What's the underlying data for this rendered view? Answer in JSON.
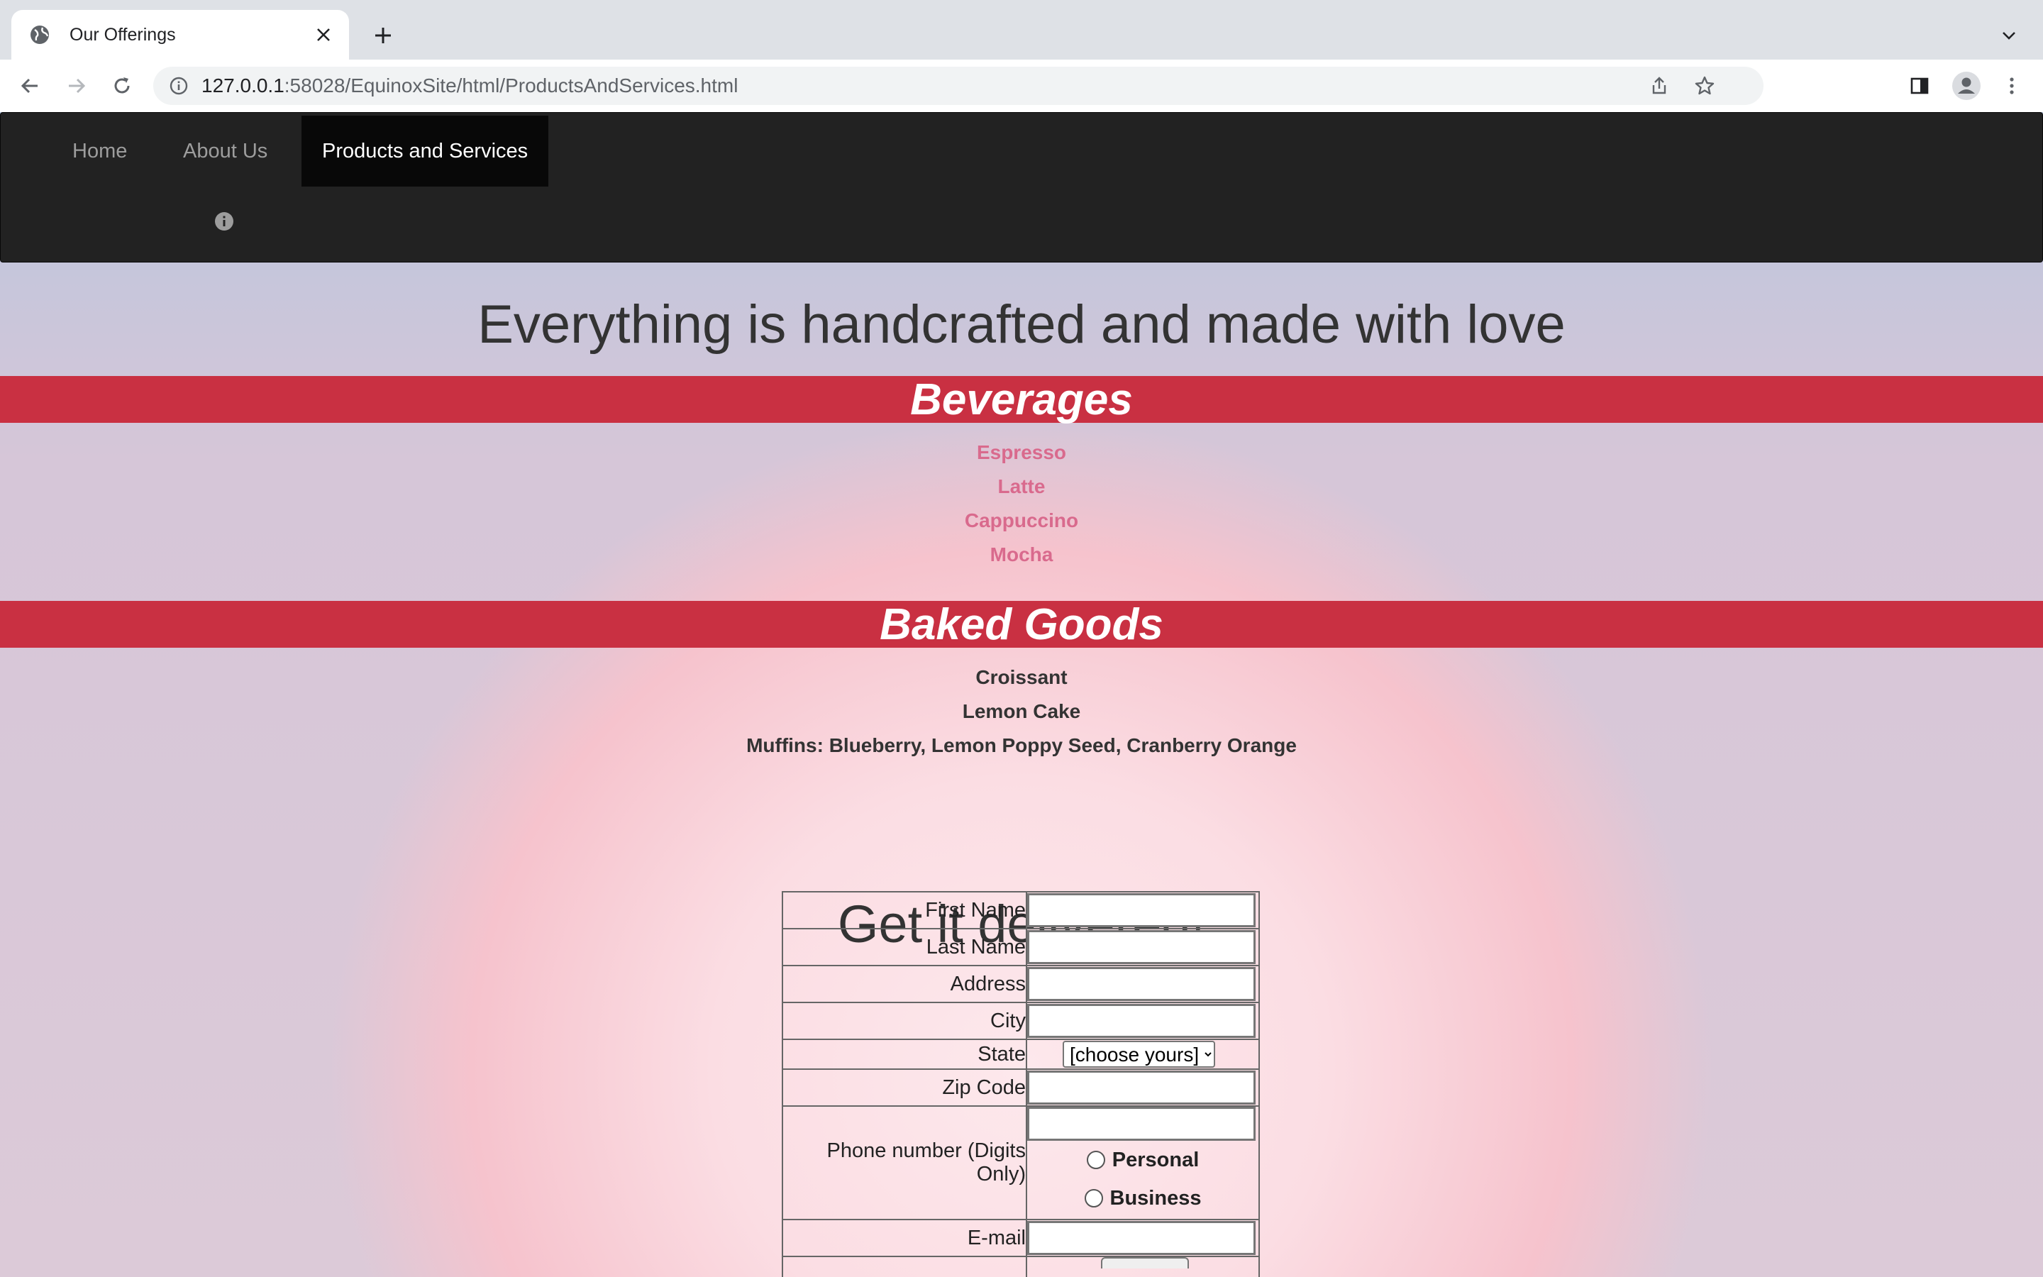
{
  "browser": {
    "tab_title": "Our Offerings",
    "url_host": "127.0.0.1",
    "url_rest": ":58028/EquinoxSite/html/ProductsAndServices.html"
  },
  "nav": {
    "items": [
      "Home",
      "About Us",
      "Products and Services"
    ],
    "active": "Products and Services"
  },
  "hero_heading": "Everything is handcrafted and made with love",
  "beverages": {
    "heading": "Beverages",
    "items": [
      "Espresso",
      "Latte",
      "Cappuccino",
      "Mocha"
    ]
  },
  "baked_goods": {
    "heading": "Baked Goods",
    "items": [
      "Croissant",
      "Lemon Cake",
      "Muffins: Blueberry, Lemon Poppy Seed, Cranberry Orange"
    ]
  },
  "delivery": {
    "heading": "Get it delivered!",
    "labels": {
      "first_name": "First Name",
      "last_name": "Last Name",
      "address": "Address",
      "city": "City",
      "state": "State",
      "zip": "Zip Code",
      "phone": "Phone number (Digits Only)",
      "email": "E-mail"
    },
    "state_selected": "[choose yours]",
    "phone_types": [
      "Personal",
      "Business"
    ]
  },
  "colors": {
    "band": "#c93042",
    "navbar": "#222222",
    "beverage_text": "#d96a8d"
  }
}
